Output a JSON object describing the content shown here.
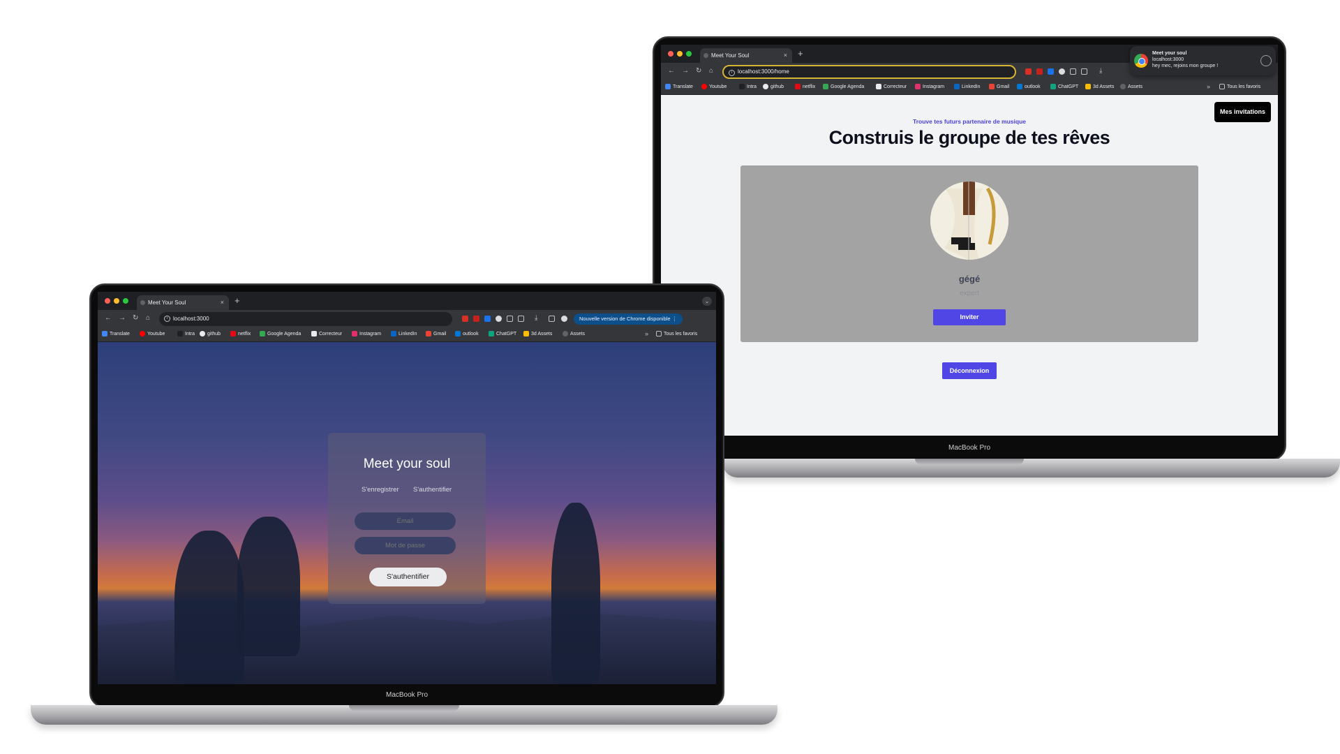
{
  "left_laptop": {
    "device_label": "MacBook Pro",
    "tab_title": "Meet Your Soul",
    "url": "localhost:3000",
    "update_notice": "Nouvelle version de Chrome disponible",
    "bookmarks": [
      "Translate",
      "Youtube",
      "Intra",
      "github",
      "netflix",
      "Google Agenda",
      "Correcteur",
      "Instagram",
      "LinkedIn",
      "Gmail",
      "outlook",
      "ChatGPT",
      "3d Assets",
      "Assets"
    ],
    "all_bookmarks": "Tous les favoris",
    "login": {
      "title": "Meet your soul",
      "register_link": "S'enregistrer",
      "signin_link": "S'authentifier",
      "email_placeholder": "Email",
      "password_placeholder": "Mot de passe",
      "submit_label": "S'authentifier"
    }
  },
  "right_laptop": {
    "device_label": "MacBook Pro",
    "tab_title": "Meet Your Soul",
    "url": "localhost:3000/home",
    "bookmarks": [
      "Translate",
      "Youtube",
      "Intra",
      "github",
      "netflix",
      "Google Agenda",
      "Correcteur",
      "Instagram",
      "LinkedIn",
      "Gmail",
      "outlook",
      "ChatGPT",
      "3d Assets",
      "Assets"
    ],
    "all_bookmarks": "Tous les favoris",
    "notification": {
      "title": "Meet your soul",
      "origin": "localhost:3000",
      "message": "hey mec, rejoins mon groupe !"
    },
    "home": {
      "invitations_button": "Mes invitations",
      "subtitle": "Trouve tes futurs partenaire de musique",
      "headline": "Construis le groupe de tes rêves",
      "profile": {
        "name": "gégé",
        "level": "expert",
        "invite_label": "Inviter"
      },
      "logout_label": "Déconnexion"
    }
  },
  "colors": {
    "accent": "#4f46e5",
    "chrome_dark": "#35363a",
    "page_bg": "#f2f3f5"
  }
}
